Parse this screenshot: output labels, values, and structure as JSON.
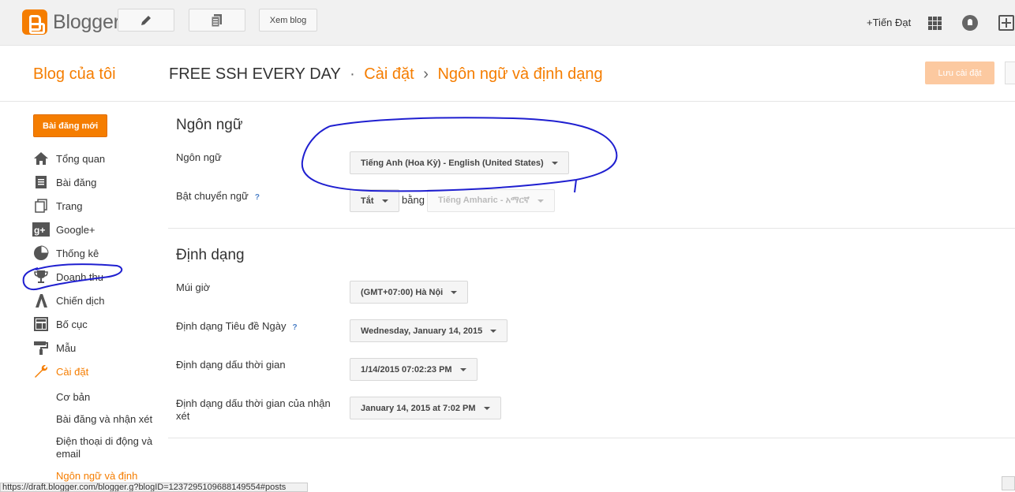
{
  "topbar": {
    "brand": "Blogger",
    "view_blog": "Xem blog",
    "user": "+Tiến Đạt"
  },
  "header": {
    "my_blogs": "Blog của tôi",
    "blog_name": "FREE SSH EVERY DAY",
    "sep1": "·",
    "crumb_settings": "Cài đặt",
    "sep2": "›",
    "crumb_page": "Ngôn ngữ và định dạng",
    "save": "Lưu cài đặt"
  },
  "sidebar": {
    "new_post": "Bài đăng mới",
    "items": [
      {
        "label": "Tổng quan",
        "icon": "home-icon"
      },
      {
        "label": "Bài đăng",
        "icon": "posts-icon"
      },
      {
        "label": "Trang",
        "icon": "pages-icon"
      },
      {
        "label": "Google+",
        "icon": "google-plus-icon"
      },
      {
        "label": "Thống kê",
        "icon": "stats-pie-icon"
      },
      {
        "label": "Doanh thu",
        "icon": "trophy-icon"
      },
      {
        "label": "Chiến dịch",
        "icon": "adwords-icon"
      },
      {
        "label": "Bố cục",
        "icon": "layout-icon"
      },
      {
        "label": "Mẫu",
        "icon": "paint-roller-icon"
      },
      {
        "label": "Cài đặt",
        "icon": "wrench-icon"
      }
    ],
    "sub_items": [
      "Cơ bản",
      "Bài đăng và nhận xét",
      "Điện thoại di động và email",
      "Ngôn ngữ và định"
    ]
  },
  "language": {
    "title": "Ngôn ngữ",
    "lang_label": "Ngôn ngữ",
    "lang_value": "Tiếng Anh (Hoa Kỳ) - English (United States)",
    "translit_label": "Bật chuyển ngữ",
    "help": "?",
    "translit_value": "Tắt",
    "by": "bằng",
    "translit_lang": "Tiếng Amharic - አማርኛ"
  },
  "format": {
    "title": "Định dạng",
    "tz_label": "Múi giờ",
    "tz_value": "(GMT+07:00) Hà Nội",
    "date_header_label": "Định dạng Tiêu đề Ngày",
    "date_header_value": "Wednesday, January 14, 2015",
    "timestamp_label": "Định dạng dấu thời gian",
    "timestamp_value": "1/14/2015 07:02:23 PM",
    "comment_ts_label": "Định dạng dấu thời gian của nhận xét",
    "comment_ts_value": "January 14, 2015 at 7:02 PM"
  },
  "status_bar": "https://draft.blogger.com/blogger.g?blogID=1237295109688149554#posts",
  "colors": {
    "accent": "#f57d00",
    "annotation": "#1f1fd0"
  }
}
